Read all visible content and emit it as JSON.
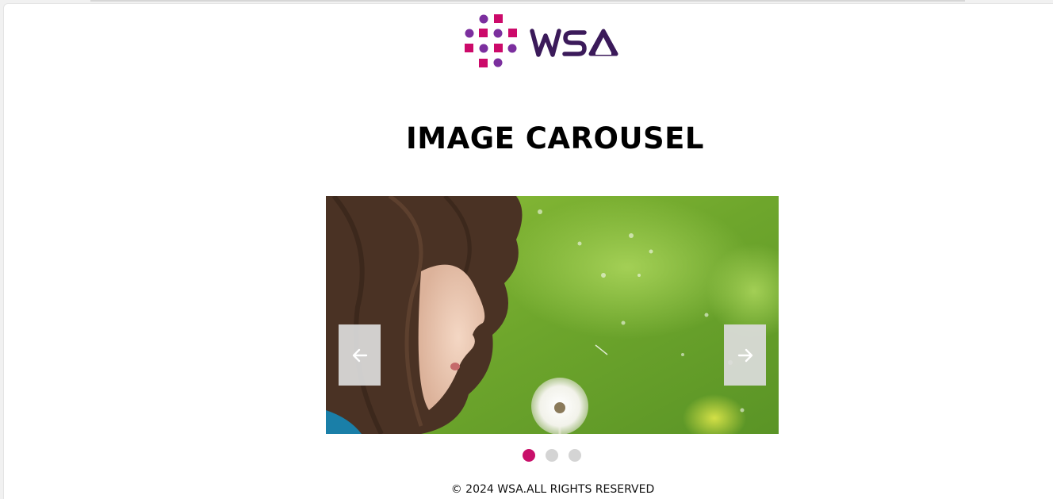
{
  "logo": {
    "text": "WSA",
    "colors": {
      "magenta": "#cc0a6a",
      "purple": "#7b2f9e",
      "dark_purple": "#3b1a5a"
    }
  },
  "heading": "IMAGE CAROUSEL",
  "carousel": {
    "current_slide": 1,
    "slide_count": 3,
    "slide_description_icon": "photo-child-blowing-dandelion",
    "prev_icon": "arrow-left-icon",
    "next_icon": "arrow-right-icon",
    "active_dot_color": "#c8106a",
    "inactive_dot_color": "#d4d4d4"
  },
  "footer": "© 2024 WSA.ALL RIGHTS RESERVED"
}
